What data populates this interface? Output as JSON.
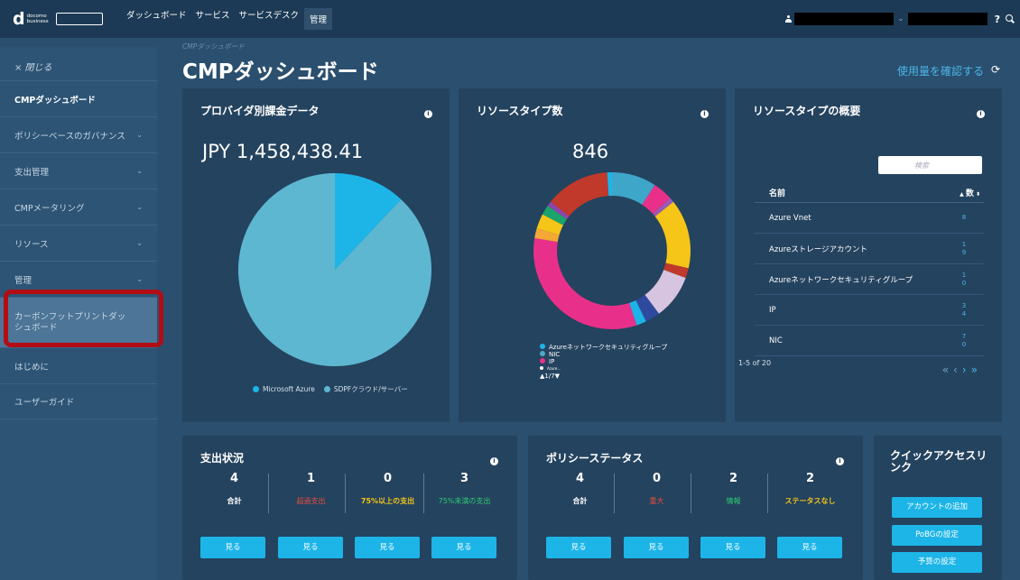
{
  "topbar": {
    "logo_word1": "docomo",
    "logo_word2": "business",
    "logo_badge": "NTT Communications",
    "nav": [
      "ダッシュボード",
      "サービス",
      "サービスデスク",
      "管理"
    ],
    "help": "?"
  },
  "sidebar": {
    "close": "× 閉じる",
    "items": [
      {
        "label": "CMPダッシュボード",
        "chevron": false
      },
      {
        "label": "ポリシーベースのガバナンス",
        "chevron": true
      },
      {
        "label": "支出管理",
        "chevron": true
      },
      {
        "label": "CMPメータリング",
        "chevron": true
      },
      {
        "label": "リソース",
        "chevron": true
      },
      {
        "label": "管理",
        "chevron": true
      },
      {
        "label": "カーボンフットプリントダッシュボード",
        "chevron": false
      },
      {
        "label": "はじめに",
        "chevron": false
      },
      {
        "label": "ユーザーガイド",
        "chevron": false
      }
    ],
    "chevron_glyph": "⌄"
  },
  "page": {
    "breadcrumb": "CMPダッシュボード",
    "title": "CMPダッシュボード",
    "usage_link": "使用量を確認する",
    "refresh": "⟳"
  },
  "billing": {
    "title": "プロバイダ別課金データ",
    "amount": "JPY 1,458,438.41",
    "legend": [
      "Microsoft Azure",
      "SDPFクラウド/サーバー"
    ],
    "colors": [
      "#1db5e8",
      "#5db7d1"
    ],
    "shares": [
      0.12,
      0.88
    ]
  },
  "resource_types": {
    "title": "リソースタイプ数",
    "count": "846",
    "legend": [
      "Azureネットワークセキュリティグループ",
      "NIC",
      "IP",
      "Azure..."
    ],
    "legend_colors": [
      "#1db5e8",
      "#4fa8c8",
      "#e8308a",
      "#ffffff"
    ],
    "pager": "▲1/7▼",
    "segments": [
      {
        "color": "#3ea6c8",
        "value": 9
      },
      {
        "color": "#e8308a",
        "value": 4
      },
      {
        "color": "#9b59b6",
        "value": 1
      },
      {
        "color": "#f5c518",
        "value": 14
      },
      {
        "color": "#c0392b",
        "value": 2
      },
      {
        "color": "#d6c4e0",
        "value": 9
      },
      {
        "color": "#2e4a9e",
        "value": 3
      },
      {
        "color": "#1db5e8",
        "value": 2
      },
      {
        "color": "#e8308a",
        "value": 32
      },
      {
        "color": "#f4a836",
        "value": 2
      },
      {
        "color": "#f5c518",
        "value": 3
      },
      {
        "color": "#1aa36b",
        "value": 2
      },
      {
        "color": "#8e44ad",
        "value": 1
      },
      {
        "color": "#c0392b",
        "value": 13
      },
      {
        "color": "#1db5e8",
        "value": 1
      }
    ]
  },
  "resource_summary": {
    "title": "リソースタイプの概要",
    "search_placeholder": "検索",
    "col_name": "名前",
    "col_count": "数",
    "rows": [
      {
        "name": "Azure Vnet",
        "value": "8"
      },
      {
        "name": "Azureストレージアカウント",
        "value": "19"
      },
      {
        "name": "Azureネットワークセキュリティグループ",
        "value": "10"
      },
      {
        "name": "IP",
        "value": "34"
      },
      {
        "name": "NIC",
        "value": "70"
      }
    ],
    "pager": "1-5 of 20"
  },
  "spend_status": {
    "title": "支出状況",
    "stats": [
      {
        "num": "4",
        "label": "合計",
        "color": "#ffffff"
      },
      {
        "num": "1",
        "label": "超過支出",
        "color": "#e74c3c"
      },
      {
        "num": "0",
        "label": "75%以上の支出",
        "color": "#f5c518"
      },
      {
        "num": "3",
        "label": "75%未満の支出",
        "color": "#2ecc71"
      }
    ],
    "view": "見る"
  },
  "policy_status": {
    "title": "ポリシーステータス",
    "stats": [
      {
        "num": "4",
        "label": "合計",
        "color": "#ffffff"
      },
      {
        "num": "0",
        "label": "重大",
        "color": "#e74c3c"
      },
      {
        "num": "2",
        "label": "情報",
        "color": "#2ecc71"
      },
      {
        "num": "2",
        "label": "ステータスなし",
        "color": "#f5c518"
      }
    ],
    "view": "見る"
  },
  "quick_access": {
    "title": "クイックアクセスリンク",
    "buttons": [
      "アカウントの追加",
      "PoBGの設定",
      "予算の設定"
    ]
  }
}
